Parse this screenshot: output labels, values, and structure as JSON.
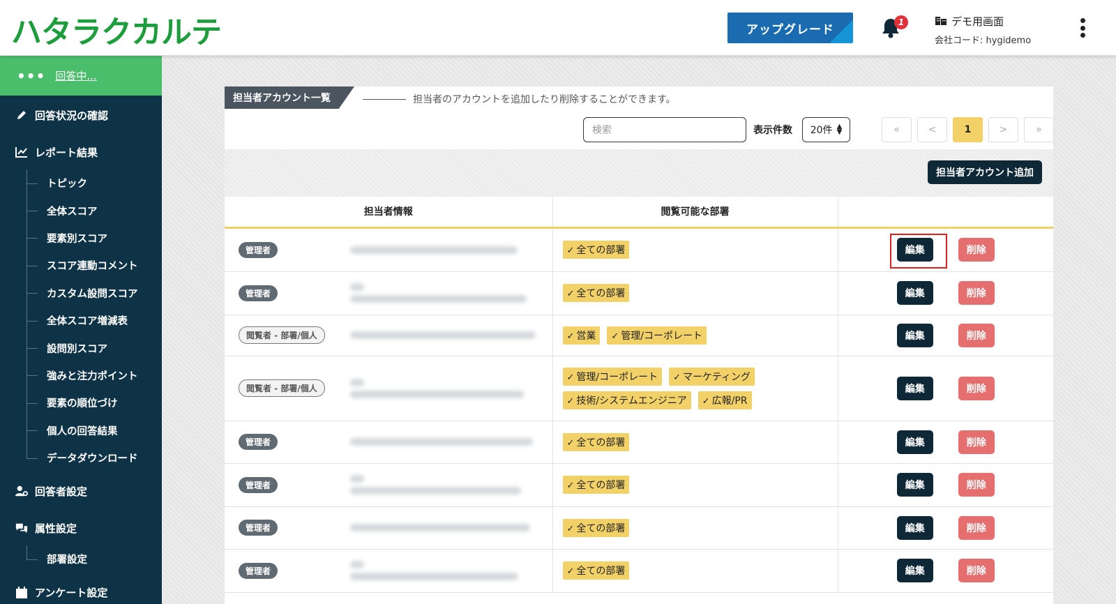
{
  "header": {
    "logo": "ハタラクカルテ",
    "upgrade_label": "アップグレード",
    "notification_count": "1",
    "company_name": "デモ用画面",
    "company_code": "会社コード: hygidemo"
  },
  "sidebar": {
    "active": {
      "dots": "•••",
      "label": "回答中..."
    },
    "sections": {
      "status": "回答状況の確認",
      "report": "レポート結果",
      "respondent": "回答者設定",
      "attribute": "属性設定",
      "survey": "アンケート設定"
    },
    "report_items": [
      "トピック",
      "全体スコア",
      "要素別スコア",
      "スコア連動コメント",
      "カスタム設問スコア",
      "全体スコア増減表",
      "設問別スコア",
      "強みと注力ポイント",
      "要素の順位づけ",
      "個人の回答結果",
      "データダウンロード"
    ],
    "attribute_items": [
      "部署設定"
    ]
  },
  "card": {
    "tab_title": "担当者アカウント一覧",
    "description": "担当者のアカウントを追加したり削除することができます。",
    "search_placeholder": "検索",
    "perpage_label": "表示件数",
    "perpage_value": "20件",
    "pager": [
      "«",
      "<",
      "1",
      ">",
      "»"
    ],
    "add_button": "担当者アカウント追加"
  },
  "table": {
    "headers": [
      "担当者情報",
      "閲覧可能な部署",
      ""
    ],
    "edit_label": "編集",
    "delete_label": "削除",
    "rows": [
      {
        "role": "管理者",
        "viewer": false,
        "blur_lines": 1,
        "tags": [
          "全ての部署"
        ]
      },
      {
        "role": "管理者",
        "viewer": false,
        "blur_lines": 2,
        "tags": [
          "全ての部署"
        ]
      },
      {
        "role": "閲覧者 - 部署/個人",
        "viewer": true,
        "blur_lines": 1,
        "tags": [
          "営業",
          "管理/コーポレート"
        ]
      },
      {
        "role": "閲覧者 - 部署/個人",
        "viewer": true,
        "blur_lines": 2,
        "tags": [
          "管理/コーポレート",
          "マーケティング",
          "技術/システムエンジニア",
          "広報/PR"
        ]
      },
      {
        "role": "管理者",
        "viewer": false,
        "blur_lines": 1,
        "tags": [
          "全ての部署"
        ]
      },
      {
        "role": "管理者",
        "viewer": false,
        "blur_lines": 2,
        "tags": [
          "全ての部署"
        ]
      },
      {
        "role": "管理者",
        "viewer": false,
        "blur_lines": 1,
        "tags": [
          "全ての部署"
        ]
      },
      {
        "role": "管理者",
        "viewer": false,
        "blur_lines": 2,
        "tags": [
          "全ての部署"
        ]
      }
    ]
  },
  "colors": {
    "brand_green": "#1e9d3c",
    "sidebar_bg": "#0e3347",
    "active_green": "#4bbe6b",
    "tag_yellow": "#f2d169",
    "delete_red": "#e56f6f",
    "primary_dark": "#0e2838"
  }
}
